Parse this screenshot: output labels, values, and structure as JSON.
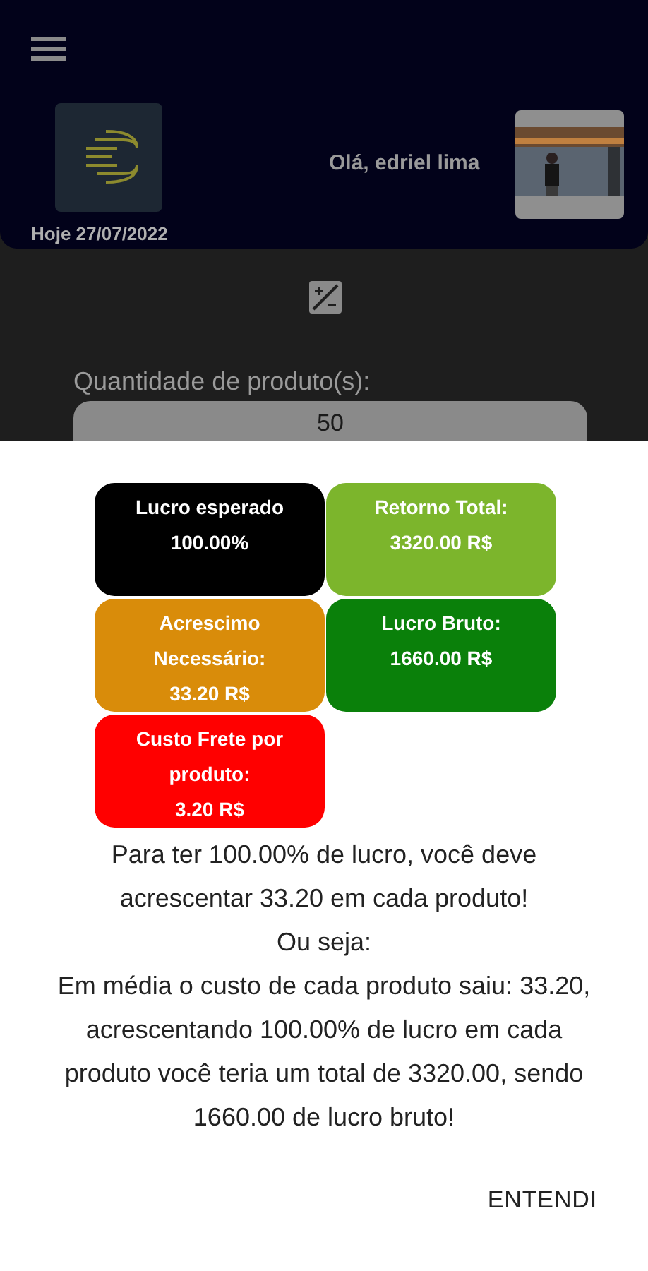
{
  "header": {
    "greeting": "Olá, edriel lima",
    "date": "Hoje 27/07/2022"
  },
  "form": {
    "label": "Quantidade de produto(s):",
    "quantity": "50"
  },
  "dialog": {
    "cards": [
      {
        "label": "Lucro esperado",
        "value": "100.00%",
        "color": "#000000"
      },
      {
        "label": "Retorno Total:",
        "value": "3320.00 R$",
        "color": "#7cb52c"
      },
      {
        "label": "Acrescimo Necessário:",
        "value": "33.20 R$",
        "color": "#d98c0a"
      },
      {
        "label": "Lucro Bruto:",
        "value": "1660.00 R$",
        "color": "#0a800a"
      },
      {
        "label": "Custo Frete por produto:",
        "value": "3.20 R$",
        "color": "#ff0000"
      }
    ],
    "message": [
      "Para ter 100.00% de lucro, você deve acrescentar 33.20 em cada produto!",
      "Ou seja:",
      "Em média o custo de cada produto saiu: 33.20, acrescentando 100.00% de lucro em cada produto você teria um total de 3320.00, sendo 1660.00 de lucro bruto!"
    ],
    "button": "ENTENDI"
  }
}
